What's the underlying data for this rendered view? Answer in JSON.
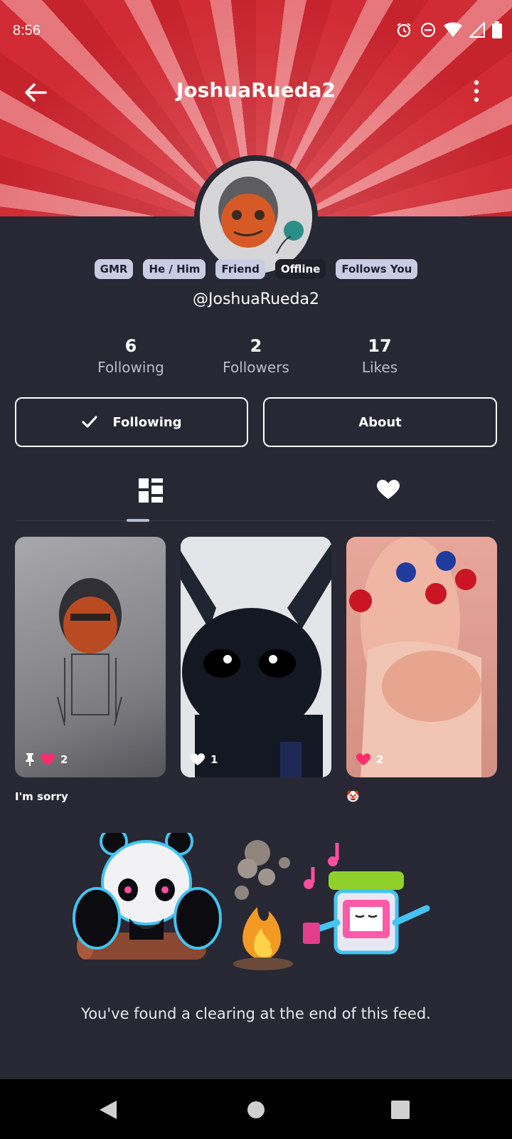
{
  "status": {
    "time": "8:56"
  },
  "header": {
    "title": "JoshuaRueda2"
  },
  "badges": [
    "GMR",
    "He / Him",
    "Friend",
    "Offline",
    "Follows You"
  ],
  "profile": {
    "handle": "@JoshuaRueda2"
  },
  "stats": [
    {
      "value": "6",
      "label": "Following"
    },
    {
      "value": "2",
      "label": "Followers"
    },
    {
      "value": "17",
      "label": "Likes"
    }
  ],
  "actions": {
    "following_label": "Following",
    "about_label": "About"
  },
  "posts": [
    {
      "likes": "2",
      "pinned": true,
      "liked": true,
      "caption": "I'm sorry"
    },
    {
      "likes": "1",
      "pinned": false,
      "liked": false,
      "caption": ""
    },
    {
      "likes": "2",
      "pinned": false,
      "liked": true,
      "caption": "🤡"
    }
  ],
  "feed_end": {
    "message": "You've found a clearing at the end of this feed."
  },
  "colors": {
    "background": "#272833",
    "banner_red": "#d5333b",
    "badge": "#c9cde3",
    "heart": "#ff2d6b"
  }
}
